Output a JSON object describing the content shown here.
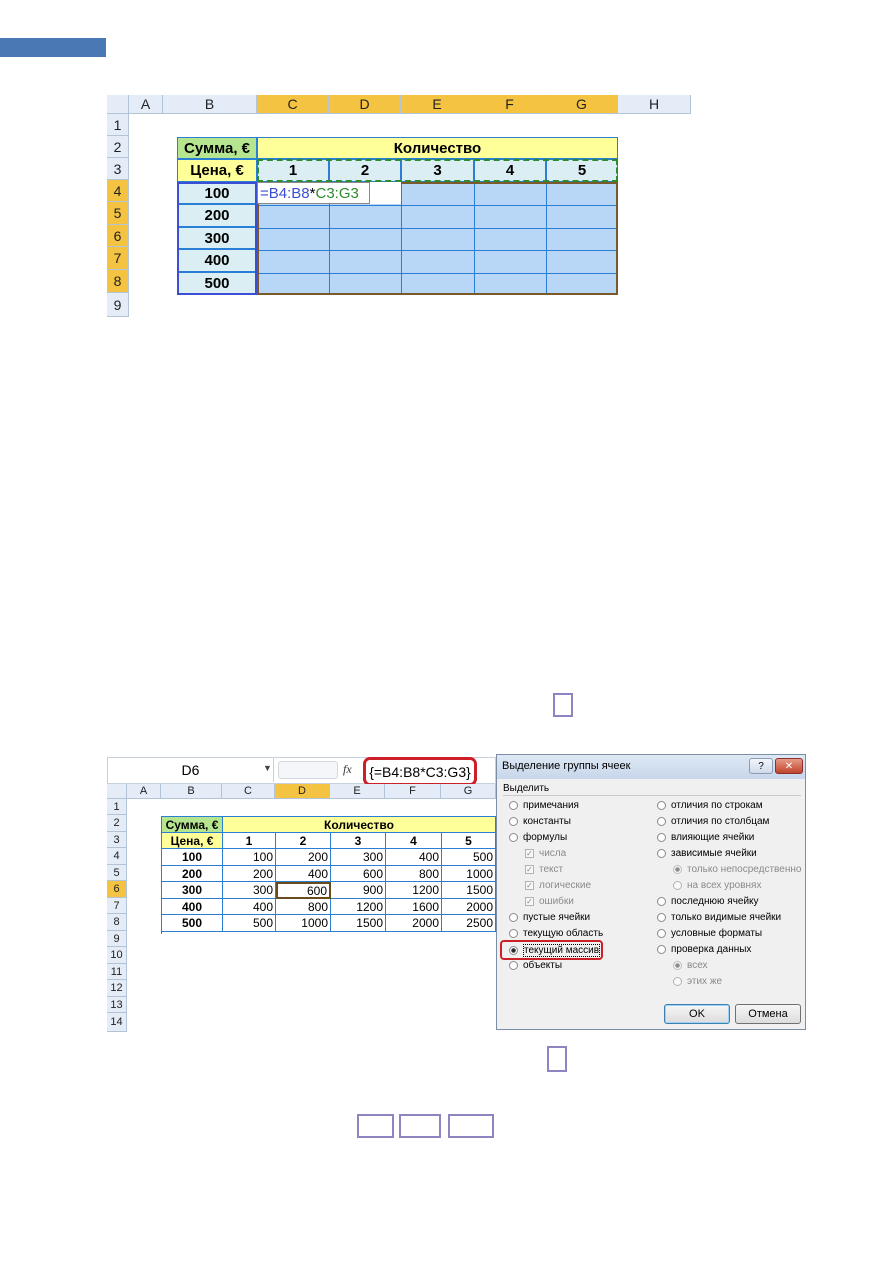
{
  "top_sheet": {
    "columns": [
      "A",
      "B",
      "C",
      "D",
      "E",
      "F",
      "G",
      "H"
    ],
    "rows": [
      "1",
      "2",
      "3",
      "4",
      "5",
      "6",
      "7",
      "8",
      "9"
    ],
    "sum_label": "Сумма, €",
    "qty_label": "Количество",
    "price_label": "Цена, €",
    "quantities": [
      "1",
      "2",
      "3",
      "4",
      "5"
    ],
    "prices": [
      "100",
      "200",
      "300",
      "400",
      "500"
    ],
    "formula_parts": {
      "eq": "=",
      "range1": "B4:B8",
      "op": "*",
      "range2": "C3:G3"
    },
    "colors": {
      "header_fill": "#ffff99",
      "sum_fill": "#b6e58f",
      "price_fill": "#daeef3",
      "selection_fill": "#b8d7f7",
      "active_header": "#f5c342",
      "range1_color": "#3b4ed6",
      "range2_color": "#2e8b2e"
    }
  },
  "bottom_sheet": {
    "name_box": "D6",
    "fx": "fx",
    "formula": "{=B4:B8*C3:G3}",
    "columns": [
      "A",
      "B",
      "C",
      "D",
      "E",
      "F",
      "G"
    ],
    "rows": [
      "1",
      "2",
      "3",
      "4",
      "5",
      "6",
      "7",
      "8",
      "9",
      "10",
      "11",
      "12",
      "13",
      "14"
    ],
    "sum_label": "Сумма, €",
    "qty_label": "Количество",
    "price_label": "Цена, €",
    "quantities": [
      "1",
      "2",
      "3",
      "4",
      "5"
    ],
    "table": [
      {
        "price": "100",
        "values": [
          "100",
          "200",
          "300",
          "400",
          "500"
        ]
      },
      {
        "price": "200",
        "values": [
          "200",
          "400",
          "600",
          "800",
          "1000"
        ]
      },
      {
        "price": "300",
        "values": [
          "300",
          "600",
          "900",
          "1200",
          "1500"
        ]
      },
      {
        "price": "400",
        "values": [
          "400",
          "800",
          "1200",
          "1600",
          "2000"
        ]
      },
      {
        "price": "500",
        "values": [
          "500",
          "1000",
          "1500",
          "2000",
          "2500"
        ]
      }
    ]
  },
  "dialog": {
    "title": "Выделение группы ячеек",
    "help": "?",
    "close": "✕",
    "group": "Выделить",
    "left": [
      "примечания",
      "константы",
      "формулы",
      "числа",
      "текст",
      "логические",
      "ошибки",
      "пустые ячейки",
      "текущую область",
      "текущий массив",
      "объекты"
    ],
    "right": [
      "отличия по строкам",
      "отличия по столбцам",
      "влияющие ячейки",
      "зависимые ячейки",
      "только непосредственно",
      "на всех уровнях",
      "последнюю ячейку",
      "только видимые ячейки",
      "условные форматы",
      "проверка данных",
      "всех",
      "этих же"
    ],
    "ok": "OK",
    "cancel": "Отмена"
  }
}
